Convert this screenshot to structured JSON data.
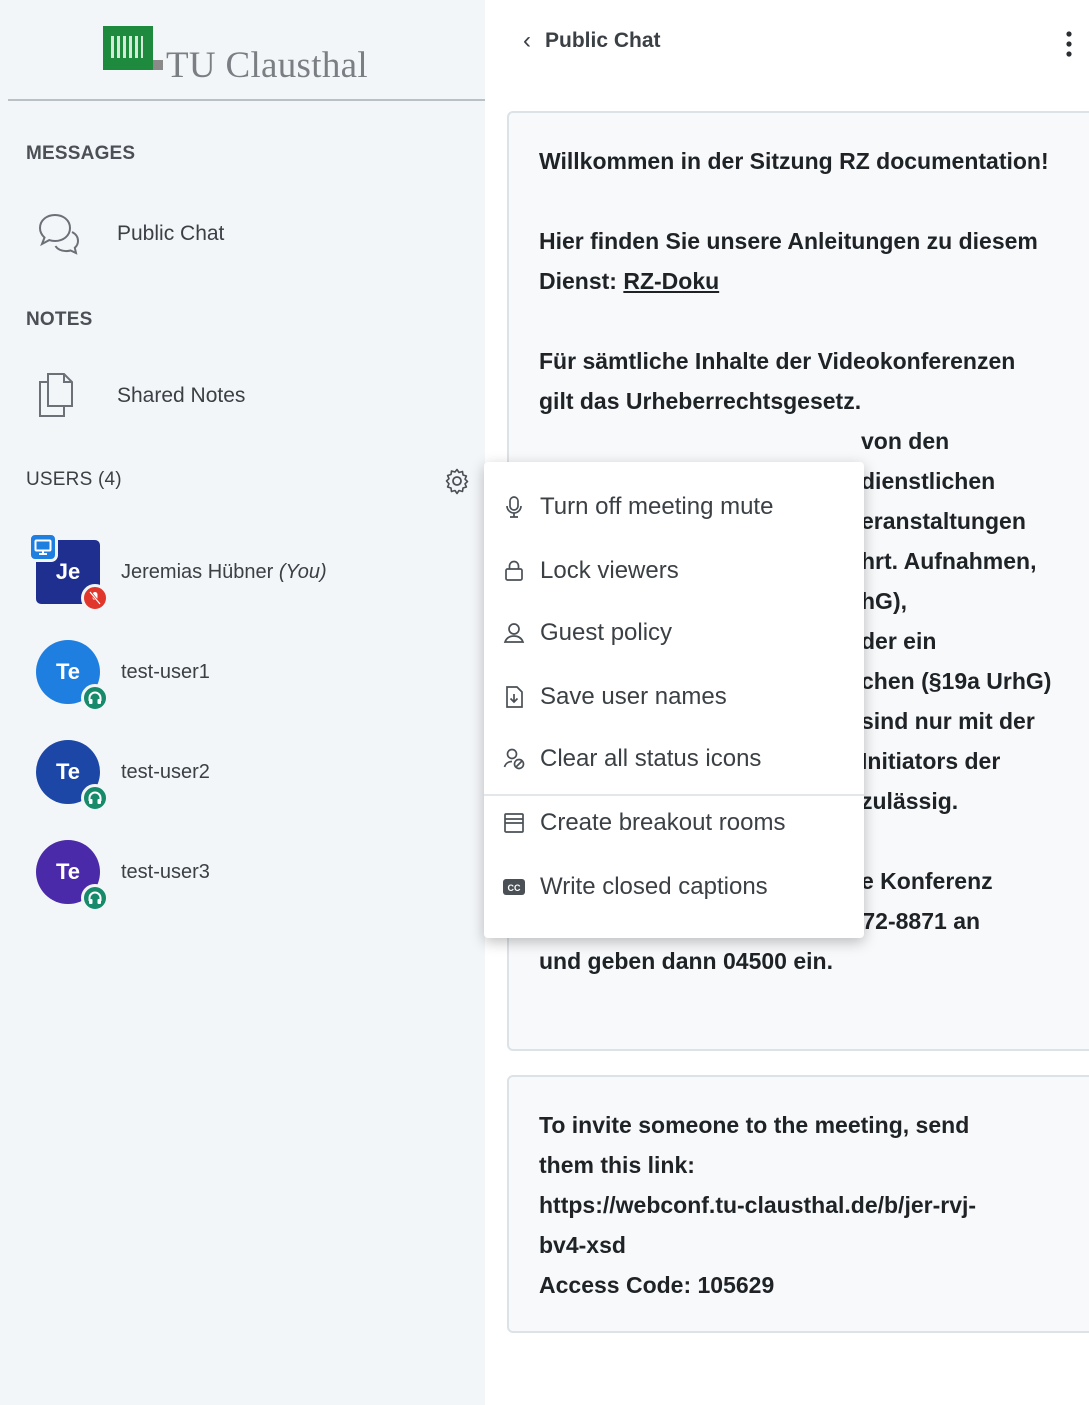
{
  "logo": {
    "name": "TU Clausthal"
  },
  "sidebar": {
    "messages_heading": "MESSAGES",
    "public_chat_label": "Public Chat",
    "notes_heading": "NOTES",
    "shared_notes_label": "Shared Notes",
    "users_heading": "USERS (4)",
    "users": [
      {
        "initials": "Je",
        "name": "Jeremias Hübner",
        "suffix": "(You)",
        "color": "#1e2f8f",
        "status": "muted",
        "presenter": true
      },
      {
        "initials": "Te",
        "name": "test-user1",
        "suffix": "",
        "color": "#1f7fe0",
        "status": "listen-only"
      },
      {
        "initials": "Te",
        "name": "test-user2",
        "suffix": "",
        "color": "#1c47a6",
        "status": "listen-only"
      },
      {
        "initials": "Te",
        "name": "test-user3",
        "suffix": "",
        "color": "#4a2aa8",
        "status": "listen-only"
      }
    ]
  },
  "header": {
    "title": "Public Chat"
  },
  "chat": {
    "welcome_line1": "Willkommen in der Sitzung ",
    "welcome_bold": "RZ documentation",
    "welcome_end": "!",
    "guide_text": "Hier finden Sie unsere Anleitungen zu diesem Dienst: ",
    "guide_link": "RZ-Doku",
    "copyright_lines": [
      "Für sämtliche Inhalte der Videokonferenzen",
      "gilt das Urheberrechtsgesetz.",
      "von den",
      "dienstlichen",
      "eranstaltungen",
      "hrt. Aufnahmen,",
      "hG),",
      "der ein",
      "chen (§19a UrhG)",
      "sind nur mit der",
      "Initiators der",
      "zulässig."
    ],
    "dialin_tail": "e Konferenz",
    "dialin_lines": [
      "einzuwählen, rufen sie 05323-72-8871 an",
      "und geben dann 04500 ein."
    ],
    "invite_lines": [
      "To invite someone to the meeting, send",
      "them this link:",
      "https://webconf.tu-clausthal.de/b/jer-rvj-",
      "bv4-xsd",
      "Access Code: 105629"
    ]
  },
  "menu": {
    "items": [
      {
        "label": "Turn off meeting mute",
        "icon": "microphone-icon"
      },
      {
        "label": "Lock viewers",
        "icon": "lock-icon"
      },
      {
        "label": "Guest policy",
        "icon": "user-icon"
      },
      {
        "label": "Save user names",
        "icon": "download-file-icon"
      },
      {
        "label": "Clear all status icons",
        "icon": "clear-status-icon"
      },
      {
        "label": "Create breakout rooms",
        "icon": "rooms-icon"
      },
      {
        "label": "Write closed captions",
        "icon": "closed-captions-icon"
      }
    ]
  }
}
